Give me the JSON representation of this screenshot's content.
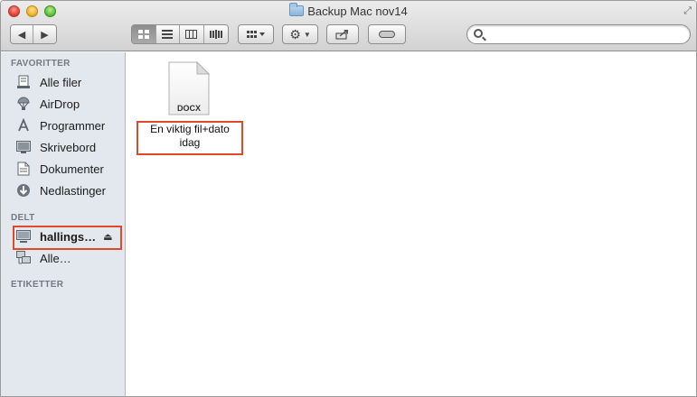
{
  "window": {
    "title": "Backup Mac nov14"
  },
  "toolbar": {
    "back_label": "◀",
    "forward_label": "▶",
    "view_icon": "▦ ☰ ▥ ▮▮▮",
    "arrange_label": "▦ ▾",
    "action_label": "⚙ ▾",
    "share_label": "⤴",
    "tag_label": "⬭"
  },
  "search": {
    "value": "",
    "placeholder": ""
  },
  "sidebar": {
    "favorites_header": "FAVORITTER",
    "favorites": [
      {
        "label": "Alle filer",
        "icon": "all-files-icon"
      },
      {
        "label": "AirDrop",
        "icon": "airdrop-icon"
      },
      {
        "label": "Programmer",
        "icon": "applications-icon"
      },
      {
        "label": "Skrivebord",
        "icon": "desktop-icon"
      },
      {
        "label": "Dokumenter",
        "icon": "documents-icon"
      },
      {
        "label": "Nedlastinger",
        "icon": "downloads-icon"
      }
    ],
    "shared_header": "DELT",
    "shared": [
      {
        "label": "hallings…",
        "icon": "computer-icon",
        "eject": "⏏"
      },
      {
        "label": "Alle…",
        "icon": "network-icon"
      }
    ],
    "tags_header": "ETIKETTER"
  },
  "content": {
    "file": {
      "type_badge": "DOCX",
      "name_line1": "En viktig fil+dato",
      "name_line2": "idag"
    }
  },
  "colors": {
    "highlight": "#e2492a",
    "sidebar_bg": "#e3e8ee"
  }
}
